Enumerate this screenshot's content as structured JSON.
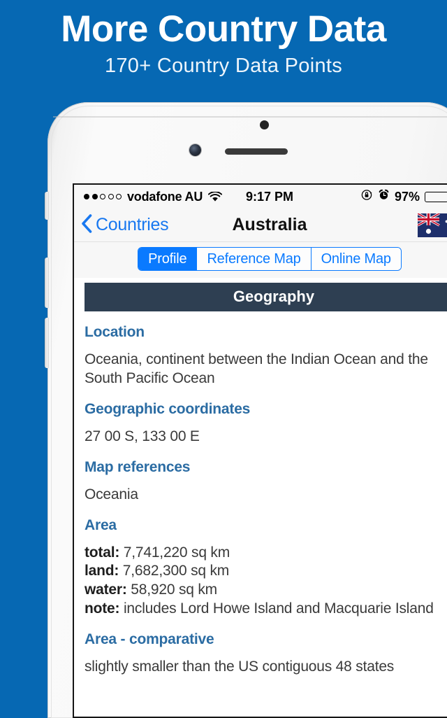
{
  "banner": {
    "title": "More Country Data",
    "subtitle": "170+ Country Data Points",
    "background_color": "#0668b3"
  },
  "device": {
    "type": "white-iphone",
    "icons": {
      "sensor": "proximity-sensor",
      "camera": "front-camera",
      "speaker": "earpiece-speaker"
    }
  },
  "status_bar": {
    "signal_dots_filled": 2,
    "signal_dots_total": 5,
    "carrier": "vodafone AU",
    "wifi": "wifi-icon",
    "time": "9:17 PM",
    "rotation_lock": "rotation-lock-icon",
    "alarm": "alarm-clock-icon",
    "battery_percent": "97%",
    "battery_level": 97,
    "battery_color": "#4cd662",
    "charging": "charging-bolt-icon"
  },
  "nav_bar": {
    "back_label": "Countries",
    "back_icon": "chevron-left-icon",
    "title": "Australia",
    "flag": "australia-flag",
    "tint_color": "#1878f0"
  },
  "segmented_control": {
    "selected_index": 0,
    "accent_color": "#0a7aff",
    "segments": [
      {
        "label": "Profile"
      },
      {
        "label": "Reference Map"
      },
      {
        "label": "Online Map"
      }
    ]
  },
  "content": {
    "section_title": "Geography",
    "section_title_bg": "#2e3f52",
    "label_color": "#2b6ca3",
    "fields": [
      {
        "label": "Location",
        "value": "Oceania, continent between the Indian Ocean and the South Pacific Ocean"
      },
      {
        "label": "Geographic coordinates",
        "value": "27 00 S, 133 00 E"
      },
      {
        "label": "Map references",
        "value": "Oceania"
      },
      {
        "label": "Area",
        "rows": [
          {
            "key": "total:",
            "value": " 7,741,220 sq km"
          },
          {
            "key": "land:",
            "value": " 7,682,300 sq km"
          },
          {
            "key": "water:",
            "value": " 58,920 sq km"
          },
          {
            "key": "note:",
            "value": " includes Lord Howe Island and Macquarie Island"
          }
        ]
      },
      {
        "label": "Area - comparative",
        "value": "slightly smaller than the US contiguous 48 states"
      }
    ]
  }
}
